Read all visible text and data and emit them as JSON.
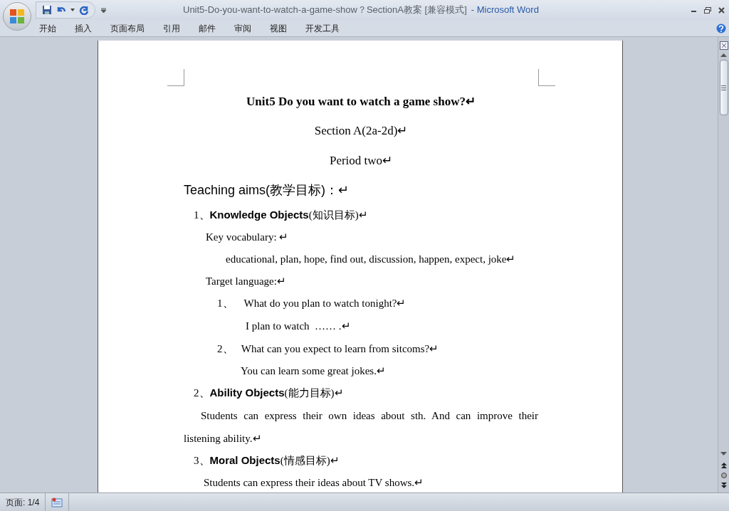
{
  "window": {
    "title": "Unit5-Do-you-want-to-watch-a-game-show？SectionA教案 [兼容模式]",
    "app_name": "- Microsoft Word"
  },
  "ribbon_tabs": [
    "开始",
    "插入",
    "页面布局",
    "引用",
    "邮件",
    "审阅",
    "视图",
    "开发工具"
  ],
  "document": {
    "paragraphs": [
      {
        "kind": "title",
        "text": "Unit5 Do you want to watch a game show?↵"
      },
      {
        "kind": "center",
        "text": "Section A(2a-2d)↵"
      },
      {
        "kind": "center",
        "text": "Period two↵"
      },
      {
        "kind": "heading",
        "text": "Teaching aims(教学目标)：↵"
      },
      {
        "kind": "item",
        "text": "1、**Knowledge Objects**(知识目标)↵"
      },
      {
        "kind": "label",
        "text": "Key vocabulary:    ↵"
      },
      {
        "kind": "vocab",
        "text": "educational, plan, hope, find out, discussion, happen, expect, joke↵"
      },
      {
        "kind": "label",
        "text": "Target language:↵"
      },
      {
        "kind": "question",
        "text": "1、    What do you plan to watch tonight?↵"
      },
      {
        "kind": "answer",
        "text": "I plan to watch  …… .↵"
      },
      {
        "kind": "question",
        "text": "2、   What can you expect to learn from sitcoms?↵"
      },
      {
        "kind": "answer2",
        "text": "You can learn some great jokes.↵"
      },
      {
        "kind": "item",
        "text": "2、**Ability Objects**(能力目标)↵"
      },
      {
        "kind": "para",
        "text": "Students can express their own ideas about sth. And can improve their listening ability.↵"
      },
      {
        "kind": "item",
        "text": "3、**Moral Objects**(情感目标)↵"
      },
      {
        "kind": "label2",
        "text": "Students can express their ideas about TV shows.↵"
      }
    ]
  },
  "status_bar": {
    "page": "页面: 1/4"
  }
}
